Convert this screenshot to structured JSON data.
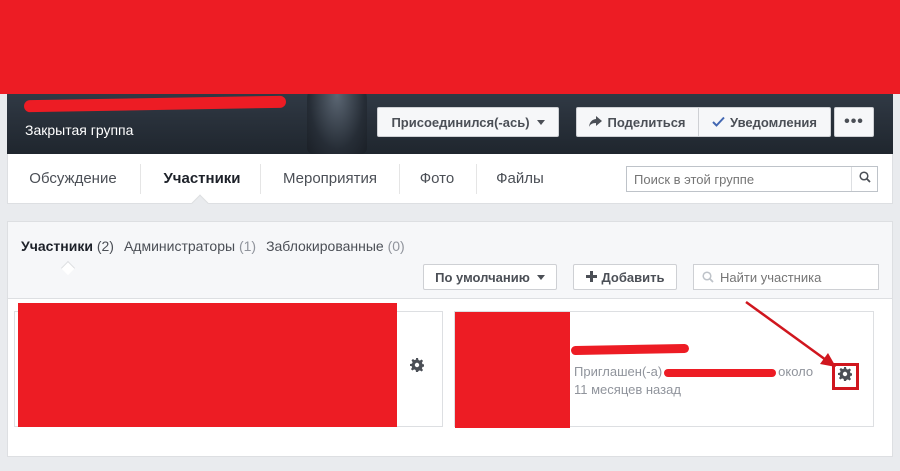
{
  "colors": {
    "redact": "#ed1c24",
    "accent": "#4267b2",
    "annotation": "#d0161e"
  },
  "header": {
    "group_type": "Закрытая группа",
    "joined_label": "Присоединился(-ась)",
    "share_label": "Поделиться",
    "notifications_label": "Уведомления",
    "more_label": "•••"
  },
  "nav": {
    "tabs": [
      {
        "label": "Обсуждение"
      },
      {
        "label": "Участники"
      },
      {
        "label": "Мероприятия"
      },
      {
        "label": "Фото"
      },
      {
        "label": "Файлы"
      }
    ],
    "active_tab": "Участники",
    "search_placeholder": "Поиск в этой группе"
  },
  "members": {
    "subtabs": [
      {
        "label": "Участники",
        "count": "(2)"
      },
      {
        "label": "Администраторы",
        "count": "(1)"
      },
      {
        "label": "Заблокированные",
        "count": "(0)"
      }
    ],
    "sort_label": "По умолчанию",
    "add_label": "Добавить",
    "find_placeholder": "Найти участника",
    "cards": [
      {
        "invited_prefix": "Приглашен(-а)",
        "invited_suffix": "около",
        "time_ago": "11 месяцев назад"
      }
    ]
  }
}
